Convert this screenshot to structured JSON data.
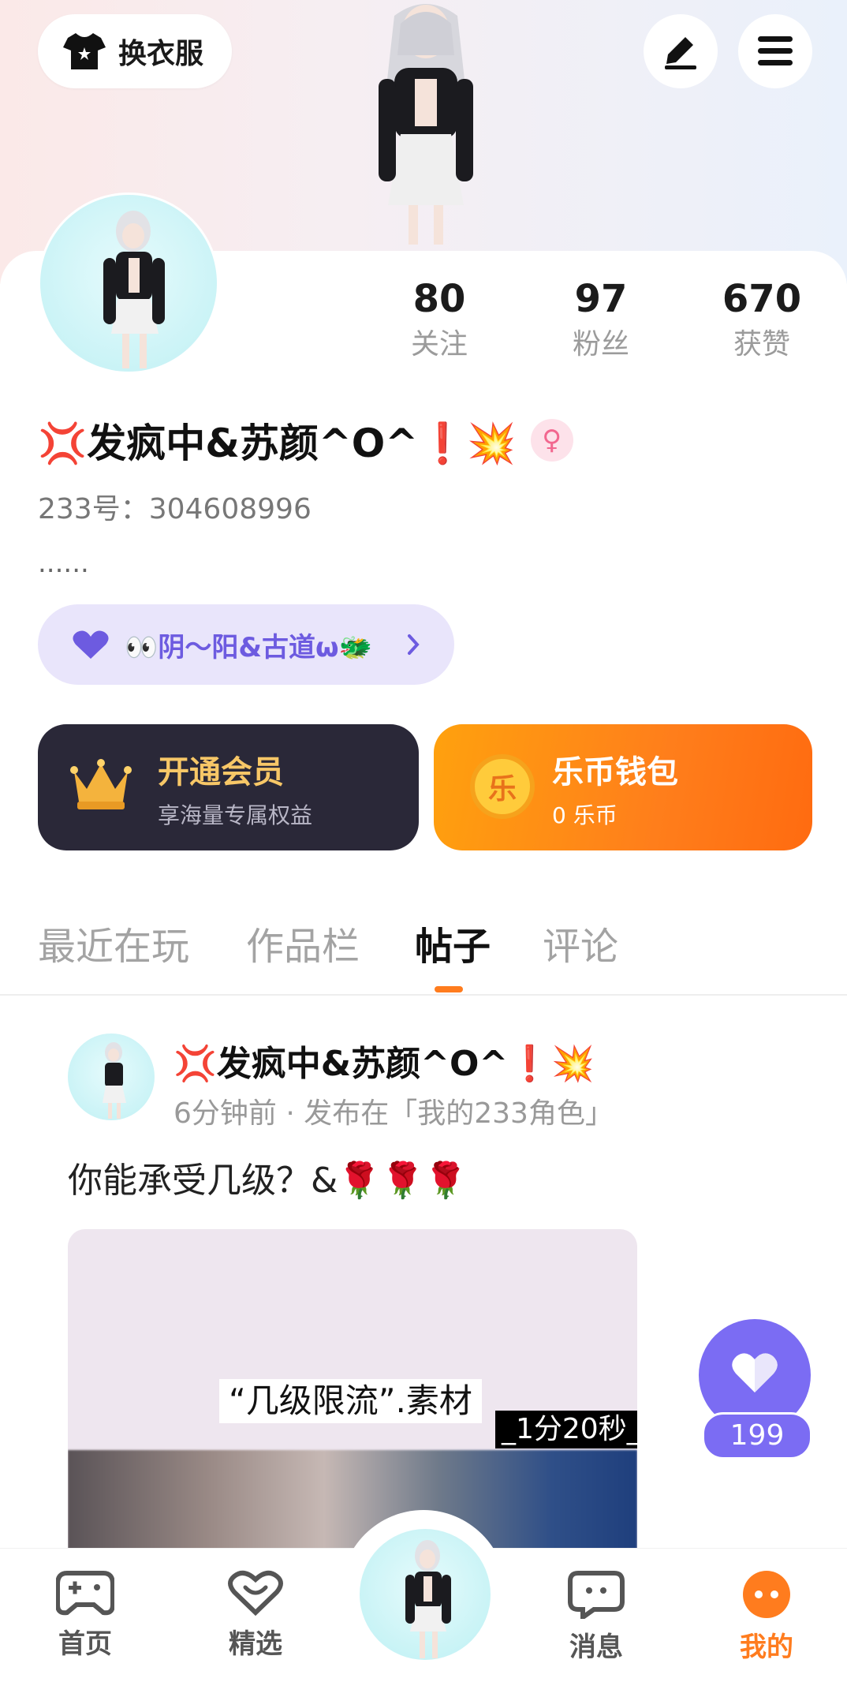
{
  "header": {
    "wardrobe_label": "换衣服"
  },
  "profile": {
    "stats": [
      {
        "value": "80",
        "label": "关注"
      },
      {
        "value": "97",
        "label": "粉丝"
      },
      {
        "value": "670",
        "label": "获赞"
      }
    ],
    "name": "💢发疯中&苏颜^O^❗💥",
    "gender_symbol": "♀",
    "uid": "233号：304608996",
    "bio": "......",
    "tag_text": "👀阴～阳&古道ω🐲"
  },
  "cards": {
    "vip": {
      "title": "开通会员",
      "subtitle": "享海量专属权益"
    },
    "wallet": {
      "title": "乐币钱包",
      "subtitle": "0 乐币",
      "coin_char": "乐"
    }
  },
  "tabs": [
    {
      "label": "最近在玩",
      "active": false
    },
    {
      "label": "作品栏",
      "active": false
    },
    {
      "label": "帖子",
      "active": true
    },
    {
      "label": "评论",
      "active": false
    }
  ],
  "post": {
    "author": "💢发疯中&苏颜^O^❗💥",
    "meta": "6分钟前 · 发布在「我的233角色」",
    "text": "你能承受几级？&🌹🌹🌹",
    "media_caption": "“几级限流”.素材",
    "media_duration": "_1分20秒_",
    "likes": "199"
  },
  "nav": [
    {
      "label": "首页",
      "icon": "gamepad-icon",
      "active": false
    },
    {
      "label": "精选",
      "icon": "heart-icon",
      "active": false
    },
    {
      "label": "消息",
      "icon": "chat-icon",
      "active": false
    },
    {
      "label": "我的",
      "icon": "profile-icon",
      "active": true
    }
  ],
  "colors": {
    "accent": "#ff7c1e",
    "purple": "#7b6cf3",
    "vip_bg": "#2a2838",
    "wallet_gold": "#ffa10e"
  }
}
